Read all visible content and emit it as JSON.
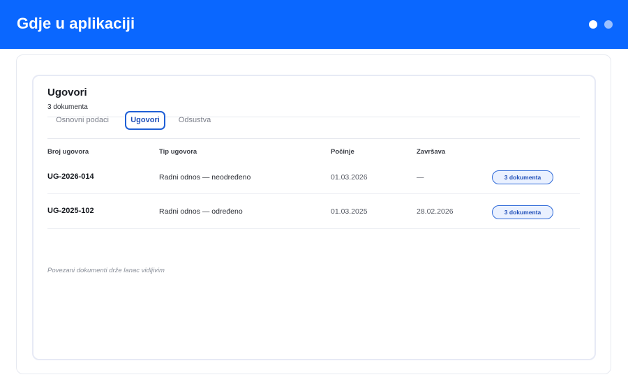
{
  "header": {
    "title": "Gdje u aplikaciji",
    "accent_color": "#0a67ff"
  },
  "card": {
    "title": "Ugovori",
    "subtitle": "3 dokumenta"
  },
  "tabs": [
    {
      "label": "Osnovni podaci",
      "active": false
    },
    {
      "label": "Ugovori",
      "active": true
    },
    {
      "label": "Odsustva",
      "active": false
    }
  ],
  "table": {
    "columns": [
      "Broj ugovora",
      "Tip ugovora",
      "Počinje",
      "Završava"
    ],
    "rows": [
      {
        "number": "UG-2026-014",
        "type": "Radni odnos — neodređeno",
        "start": "01.03.2026",
        "end": "—",
        "badge": "3 dokumenta"
      },
      {
        "number": "UG-2025-102",
        "type": "Radni odnos — određeno",
        "start": "01.03.2025",
        "end": "28.02.2026",
        "badge": "3 dokumenta"
      }
    ]
  },
  "footer_note": "Povezani dokumenti drže lanac vidljivim"
}
